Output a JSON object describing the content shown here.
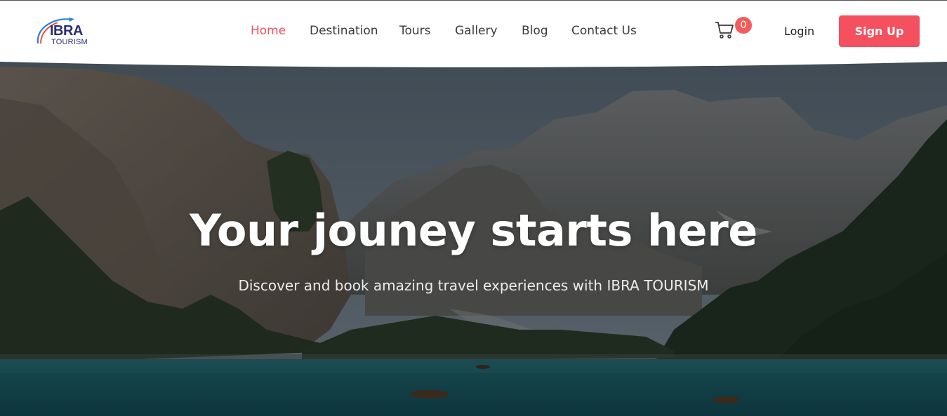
{
  "header": {
    "logo": {
      "main": "IBRA",
      "sub": "TOURISM",
      "brand_color": "#2b2d74",
      "swoosh_colors": [
        "#e84c3d",
        "#2f7fd6"
      ]
    },
    "nav": [
      {
        "label": "Home",
        "active": true
      },
      {
        "label": "Destination",
        "active": false
      },
      {
        "label": "Tours",
        "active": false
      },
      {
        "label": "Gallery",
        "active": false
      },
      {
        "label": "Blog",
        "active": false
      },
      {
        "label": "Contact Us",
        "active": false
      }
    ],
    "cart": {
      "icon": "shopping-cart-icon",
      "count": "0"
    },
    "login_label": "Login",
    "signup_label": "Sign Up"
  },
  "hero": {
    "title": "Your jouney starts here",
    "subtitle": "Discover and book amazing travel experiences with IBRA TOURISM"
  },
  "colors": {
    "accent": "#f4505f",
    "active_nav": "#f0525e",
    "nav_text": "#3b3b3b",
    "badge": "#f25c5c"
  }
}
